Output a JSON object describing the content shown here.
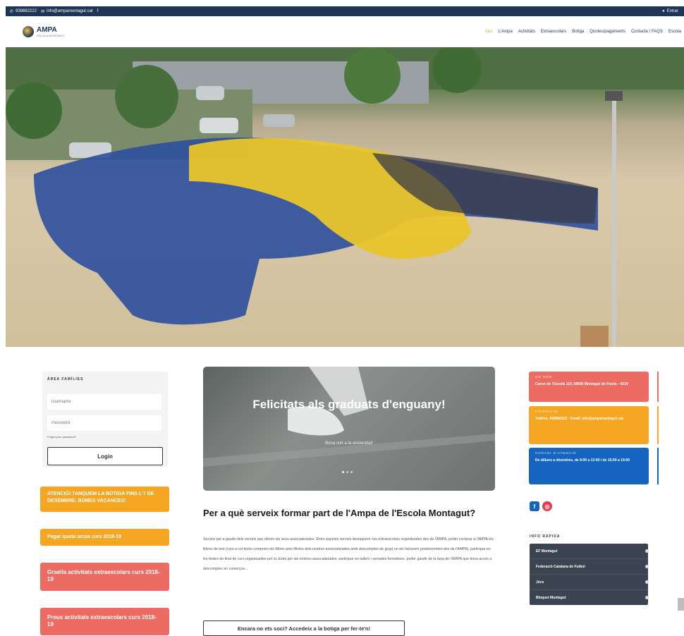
{
  "topbar": {
    "phone": "938882222",
    "email": "info@ampamontagut.cat",
    "facebook_glyph": "f",
    "right_label": "Entrar"
  },
  "header": {
    "logo_title": "AMPA",
    "logo_subtitle": "ESCOLA MONTAGUT",
    "nav": [
      "Inici",
      "L'Ampa",
      "Activitats",
      "Extraescolars",
      "Botiga",
      "Quotes/pagaments",
      "Contacte / FAQS",
      "Escola"
    ]
  },
  "login": {
    "title": "ÀREA FAMÍLIES",
    "username_placeholder": "Username",
    "password_placeholder": "Password",
    "forgot": "Forgot your password?",
    "button": "Login"
  },
  "promos": [
    {
      "text": "ATENCIÓ! TANQUEM LA BOTIGA FINS L'7 DE DESEMBRE. BONES VACANCES!",
      "color": "#f5a623"
    },
    {
      "text": "Pagar quota ampa curs 2018-19",
      "color": "#f5a623"
    },
    {
      "text": "Graella activitats extraescolars curs 2018-19",
      "color": "#ec6b63"
    },
    {
      "text": "Preus activitats extraescolars curs 2018-19",
      "color": "#ec6b63"
    }
  ],
  "slider": {
    "title": "Felicitats als graduats d'enguany!",
    "subtitle": "Bona sort a la universitat!",
    "active_dot": 0
  },
  "main": {
    "heading": "Per a què serveix formar part de l'Ampa de l'Escola Montagut?",
    "body": "Serveix per a gaudir dels serveis que oferim als seus associats/ades. Entre aquests serveis destaquem: les extraescolars organitzades des de l'AMPA, poder comprar a l'AMPA els llibres de text (com a col·lectiu comprem els llibres pels fills/es dels nostres associats/ades amb descomptes de grup) on els facturem posteriorment des de l'AMPA), participar en les festes de final de curs organitzades per la Junta per als nostres associats/ades, participar en tallers i xerrades formatives, poder gaudir de la tarja de l'AMPA que dona accés a descomptes en comerços...",
    "cta": "Encara no ets soci? Accedeix a la botiga per fer-te'n!"
  },
  "contact": [
    {
      "label": "ON SOM",
      "value": "Carrer de l'Escola 110, 08500 Montagut de Fluvià – BCN",
      "color": "#ec6b63"
    },
    {
      "label": "CONTACTE",
      "value": "Telèfon: 938882222 · Email: info@ampamontagut.cat",
      "color": "#f5a623"
    },
    {
      "label": "HORARI D'ATENCIÓ",
      "value": "De dilluns a divendres, de 9:00 a 13:00 i de 15:00 a 19:00",
      "color": "#1565c0"
    }
  ],
  "social": {
    "facebook": "f",
    "instagram": "◎",
    "facebook_color": "#1565c0",
    "instagram_color": "#e53950"
  },
  "quick_info": {
    "title": "INFO RÀPIDA",
    "items": [
      "EF Montagut",
      "Federació Catalana de Futbol",
      "Jocs",
      "Bloquet Montagut"
    ]
  }
}
